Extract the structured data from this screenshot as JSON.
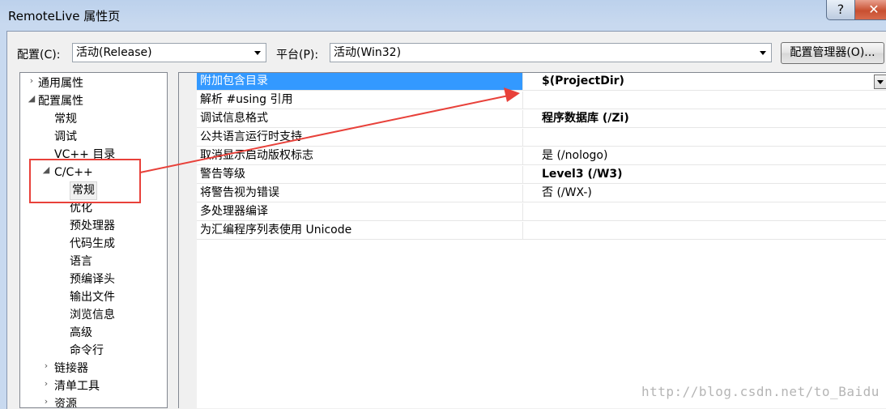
{
  "window": {
    "title": "RemoteLive 属性页",
    "help_label": "?",
    "close_label": "✕"
  },
  "toolbar": {
    "config_label": "配置(C):",
    "config_value": "活动(Release)",
    "platform_label": "平台(P):",
    "platform_value": "活动(Win32)",
    "config_manager_label": "配置管理器(O)..."
  },
  "tree": {
    "items": [
      {
        "label": "通用属性",
        "expander": "›"
      },
      {
        "label": "配置属性",
        "expander": "◢"
      },
      {
        "label": "常规"
      },
      {
        "label": "调试"
      },
      {
        "label": "VC++ 目录"
      },
      {
        "label": "C/C++",
        "expander": "◢"
      },
      {
        "label": "常规"
      },
      {
        "label": "优化"
      },
      {
        "label": "预处理器"
      },
      {
        "label": "代码生成"
      },
      {
        "label": "语言"
      },
      {
        "label": "预编译头"
      },
      {
        "label": "输出文件"
      },
      {
        "label": "浏览信息"
      },
      {
        "label": "高级"
      },
      {
        "label": "命令行"
      },
      {
        "label": "链接器",
        "expander": "›"
      },
      {
        "label": "清单工具",
        "expander": "›"
      },
      {
        "label": "资源",
        "expander": "›"
      }
    ]
  },
  "properties": [
    {
      "name": "附加包含目录",
      "value": "$(ProjectDir)",
      "bold": true,
      "selected": true
    },
    {
      "name": "解析 #using 引用",
      "value": ""
    },
    {
      "name": "调试信息格式",
      "value": "程序数据库 (/Zi)",
      "bold": true
    },
    {
      "name": "公共语言运行时支持",
      "value": ""
    },
    {
      "name": "取消显示启动版权标志",
      "value": "是 (/nologo)"
    },
    {
      "name": "警告等级",
      "value": "Level3 (/W3)",
      "bold": true
    },
    {
      "name": "将警告视为错误",
      "value": "否 (/WX-)"
    },
    {
      "name": "多处理器编译",
      "value": ""
    },
    {
      "name": "为汇编程序列表使用 Unicode",
      "value": ""
    }
  ],
  "watermark": "http://blog.csdn.net/to_Baidu",
  "colors": {
    "selection": "#3399ff",
    "annotation": "#e8413a"
  }
}
